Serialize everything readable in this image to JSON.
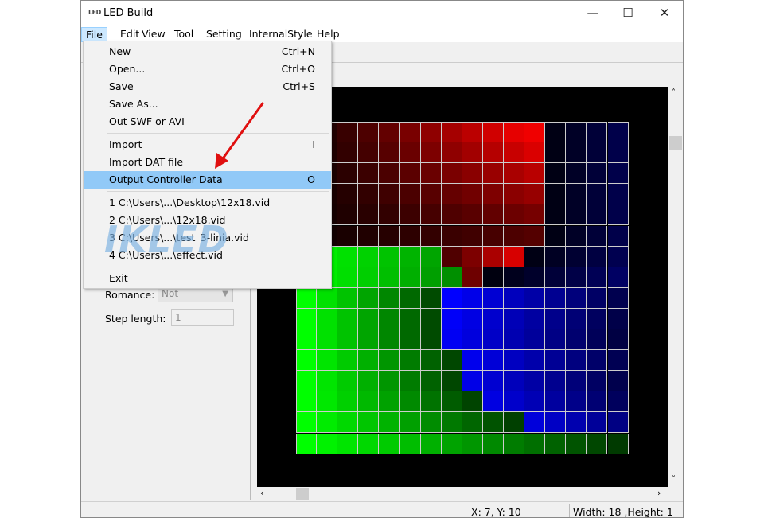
{
  "window": {
    "title": "LED Build",
    "icon_text": "LED",
    "controls": {
      "minimize": "—",
      "maximize": "☐",
      "close": "✕"
    }
  },
  "menubar": {
    "items": [
      "File",
      "Edit",
      "View",
      "Tool",
      "Setting",
      "InternalStyle",
      "Help"
    ]
  },
  "file_menu": {
    "items": [
      {
        "label": "New",
        "shortcut": "Ctrl+N"
      },
      {
        "label": "Open...",
        "shortcut": "Ctrl+O"
      },
      {
        "label": "Save",
        "shortcut": "Ctrl+S"
      },
      {
        "label": "Save As...",
        "shortcut": ""
      },
      {
        "label": "Out SWF or AVI",
        "shortcut": ""
      },
      {
        "label": "Import",
        "shortcut": "I"
      },
      {
        "label": "Import DAT file",
        "shortcut": ""
      },
      {
        "label": "Output Controller Data",
        "shortcut": "O"
      },
      {
        "label": "1 C:\\Users\\...\\Desktop\\12x18.vid",
        "shortcut": ""
      },
      {
        "label": "2 C:\\Users\\...\\12x18.vid",
        "shortcut": ""
      },
      {
        "label": "3 C:\\Users\\...\\test_3-linia.vid",
        "shortcut": ""
      },
      {
        "label": "4 C:\\Users\\...\\effect.vid",
        "shortcut": ""
      },
      {
        "label": "Exit",
        "shortcut": ""
      }
    ],
    "highlighted": "Output Controller Data"
  },
  "left_panel": {
    "romance_label": "Romance:",
    "romance_value": "Not",
    "step_label": "Step length:",
    "step_value": "1"
  },
  "scroll": {
    "left": "‹",
    "right": "›",
    "up": "˄",
    "down": "˅"
  },
  "grid": {
    "columns": 16,
    "rows": 16
  },
  "status": {
    "coords": "X: 7, Y: 10",
    "size": "Width: 18 ,Height: 1"
  },
  "watermark": "IKLED",
  "colors": {
    "menu_highlight": "#91c9f7",
    "arrow": "#e01010",
    "canvas": "#000000"
  }
}
